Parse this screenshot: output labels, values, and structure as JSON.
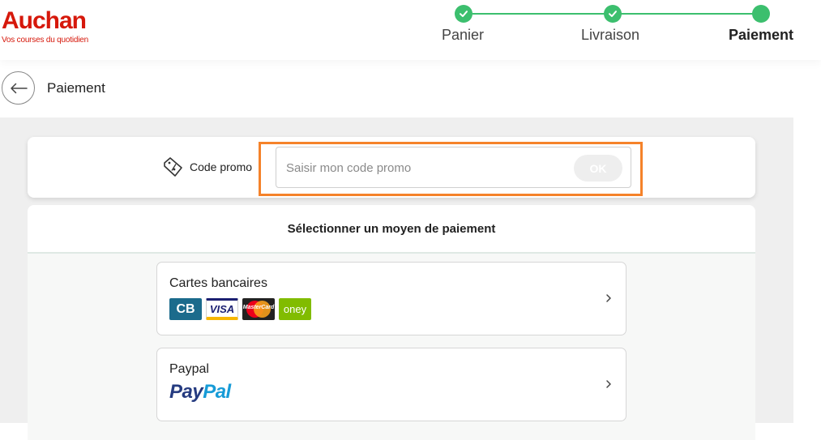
{
  "brand": {
    "name": "Auchan",
    "tagline": "Vos courses du quotidien",
    "color": "#d6180b"
  },
  "stepper": {
    "steps": [
      {
        "label": "Panier",
        "state": "done"
      },
      {
        "label": "Livraison",
        "state": "done"
      },
      {
        "label": "Paiement",
        "state": "current"
      }
    ],
    "accent_color": "#3cbf6e"
  },
  "page": {
    "title": "Paiement",
    "back_icon": "arrow-left-icon"
  },
  "promo": {
    "label": "Code promo",
    "icon": "percent-tag-icon",
    "input_value": "",
    "placeholder": "Saisir mon code promo",
    "ok_label": "OK",
    "highlight_color": "#f5822a"
  },
  "payment": {
    "title": "Sélectionner un moyen de paiement",
    "methods": [
      {
        "label": "Cartes bancaires",
        "logos": [
          "CB",
          "VISA",
          "MasterCard",
          "oney"
        ]
      },
      {
        "label": "Paypal",
        "logo_part1": "Pay",
        "logo_part2": "Pal"
      }
    ]
  }
}
